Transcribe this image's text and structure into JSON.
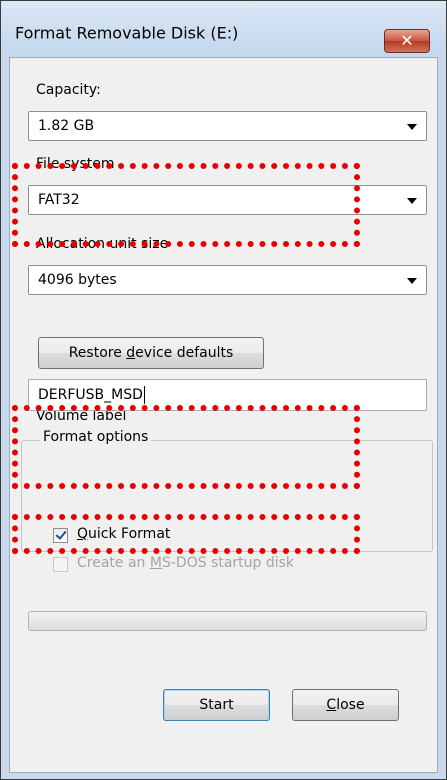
{
  "window": {
    "title": "Format Removable Disk (E:)",
    "close_glyph": "✕"
  },
  "capacity": {
    "label": "Capacity:",
    "value": "1.82 GB"
  },
  "file_system": {
    "label": "File system",
    "value": "FAT32"
  },
  "allocation": {
    "label": "Allocation unit size",
    "value": "4096 bytes"
  },
  "restore_button": {
    "label_before": "Restore ",
    "label_underlined": "d",
    "label_after": "evice defaults"
  },
  "volume": {
    "label": "Volume label",
    "value": "DERFUSB_MSD"
  },
  "format_options": {
    "title": "Format options",
    "quick_format": {
      "label_underlined": "Q",
      "label_after": "uick Format",
      "checked": true
    },
    "msdos": {
      "label_before": "Create an ",
      "label_underlined": "M",
      "label_after": "S-DOS startup disk",
      "checked": false,
      "enabled": false
    }
  },
  "progress": {
    "value": 0
  },
  "buttons": {
    "start": "Start",
    "close_underlined": "C",
    "close_after": "lose"
  },
  "colors": {
    "highlight": "#e60000",
    "window_frame": "#c9d9ec",
    "client_bg": "#f0f0f0",
    "close_button": "#c8533e"
  }
}
